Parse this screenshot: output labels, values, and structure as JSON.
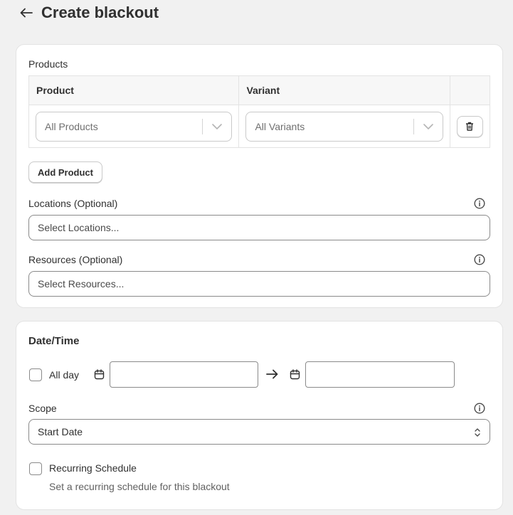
{
  "header": {
    "title": "Create blackout"
  },
  "products": {
    "label": "Products",
    "columns": [
      "Product",
      "Variant"
    ],
    "row": {
      "product": "All Products",
      "variant": "All Variants"
    },
    "add_button": "Add Product"
  },
  "locations": {
    "label": "Locations (Optional)",
    "placeholder": "Select Locations..."
  },
  "resources": {
    "label": "Resources (Optional)",
    "placeholder": "Select Resources..."
  },
  "datetime": {
    "title": "Date/Time",
    "all_day_label": "All day",
    "start_value": "",
    "end_value": ""
  },
  "scope": {
    "label": "Scope",
    "value": "Start Date"
  },
  "recurring": {
    "label": "Recurring Schedule",
    "help": "Set a recurring schedule for this blackout"
  }
}
